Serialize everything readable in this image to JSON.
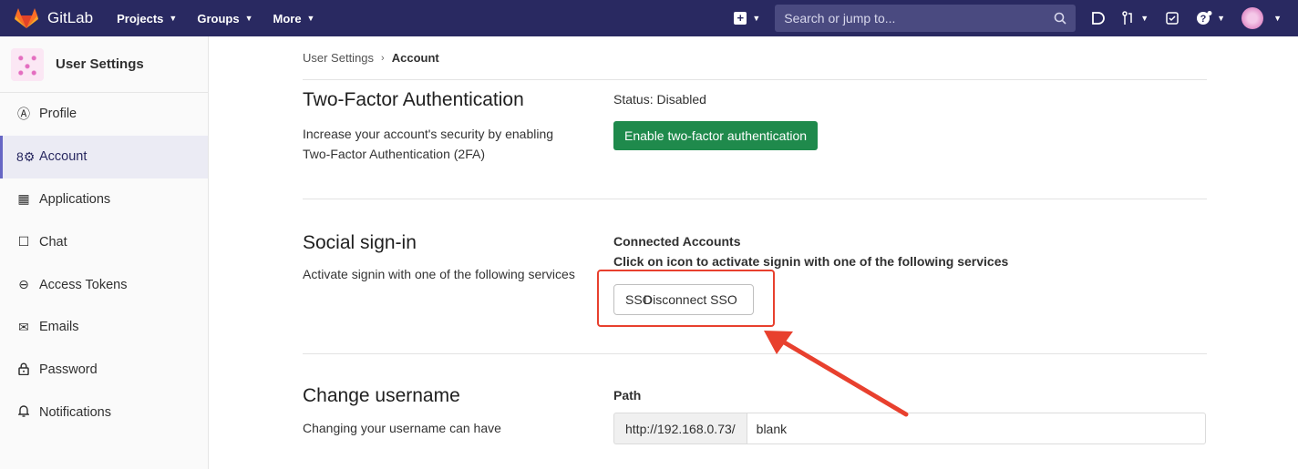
{
  "navbar": {
    "brand": "GitLab",
    "menu": [
      {
        "label": "Projects"
      },
      {
        "label": "Groups"
      },
      {
        "label": "More"
      }
    ],
    "search_placeholder": "Search or jump to..."
  },
  "sidebar": {
    "title": "User Settings",
    "items": [
      {
        "label": "Profile",
        "icon": "profile-icon",
        "glyph": "Ⓐ"
      },
      {
        "label": "Account",
        "icon": "account-icon",
        "glyph": "8⚙"
      },
      {
        "label": "Applications",
        "icon": "applications-icon",
        "glyph": "▦"
      },
      {
        "label": "Chat",
        "icon": "chat-icon",
        "glyph": "☐"
      },
      {
        "label": "Access Tokens",
        "icon": "token-icon",
        "glyph": "⊖"
      },
      {
        "label": "Emails",
        "icon": "email-icon",
        "glyph": "✉"
      },
      {
        "label": "Password",
        "icon": "lock-icon",
        "glyph": "🔒"
      },
      {
        "label": "Notifications",
        "icon": "bell-icon",
        "glyph": "🔔"
      }
    ]
  },
  "breadcrumb": {
    "parent": "User Settings",
    "current": "Account"
  },
  "two_factor": {
    "title": "Two-Factor Authentication",
    "description": "Increase your account's security by enabling Two-Factor Authentication (2FA)",
    "status": "Status: Disabled",
    "button": "Enable two-factor authentication"
  },
  "social": {
    "title": "Social sign-in",
    "description": "Activate signin with one of the following services",
    "connected_label": "Connected Accounts",
    "hint": "Click on icon to activate signin with one of the following services",
    "sso_label": "SSO",
    "disconnect_label": "Disconnect SSO"
  },
  "username": {
    "title": "Change username",
    "description": "Changing your username can have",
    "path_label": "Path",
    "path_prefix": "http://192.168.0.73/",
    "path_value": "blank"
  },
  "colors": {
    "navbar": "#292961",
    "success": "#1f8a4c",
    "annotation": "#e8402e"
  }
}
